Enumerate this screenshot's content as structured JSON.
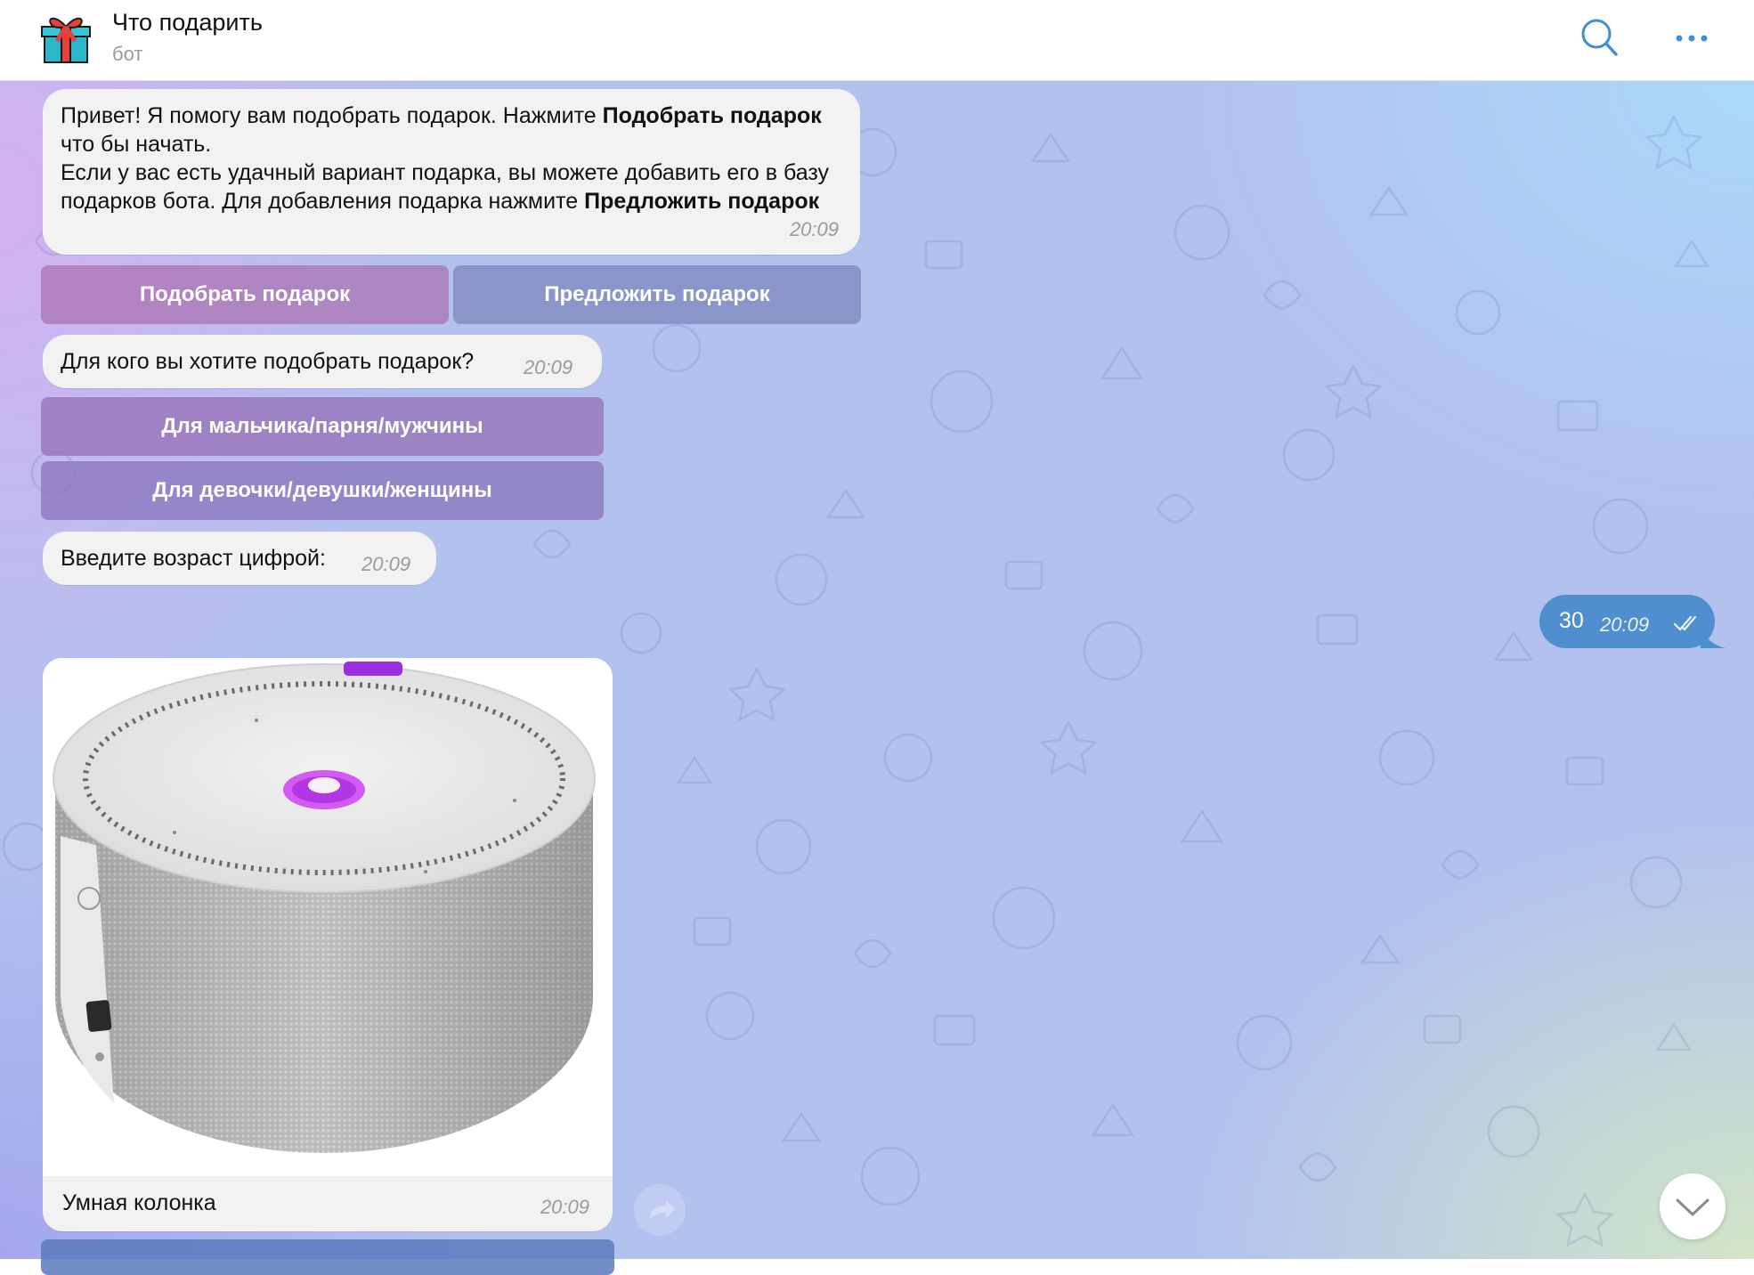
{
  "header": {
    "title": "Что подарить",
    "subtitle": "бот",
    "avatar_icon": "gift-icon",
    "search_icon": "search-icon",
    "more_icon": "more-dots-icon"
  },
  "messages": {
    "welcome": {
      "text_line1_start": "Привет! Я помогу вам подобрать подарок. Нажмите ",
      "text_line1_bold": "Подобрать подарок",
      "text_line1_end": " что бы начать.",
      "text_line2_start": "Если у вас есть удачный вариант подарка, вы можете добавить его в базу подарков бота. Для добавления подарка нажмите ",
      "text_line2_bold": "Предложить подарок",
      "time": "20:09"
    },
    "who_for": {
      "text": "Для кого вы хотите подобрать подарок?",
      "time": "20:09"
    },
    "age_prompt": {
      "text": "Введите возраст цифрой:",
      "time": "20:09"
    },
    "user_reply": {
      "text": "30",
      "time": "20:09"
    },
    "gift_card": {
      "caption": "Умная колонка",
      "time": "20:09"
    }
  },
  "keyboards": {
    "start": [
      "Подобрать подарок",
      "Предложить подарок"
    ],
    "recipient": [
      "Для мальчика/парня/мужчины",
      "Для девочки/девушки/женщины"
    ]
  },
  "colors": {
    "outgoing_bubble": "#4f8fd0",
    "incoming_bubble": "#f2f2f2",
    "accent_purple": "#b040e0"
  }
}
